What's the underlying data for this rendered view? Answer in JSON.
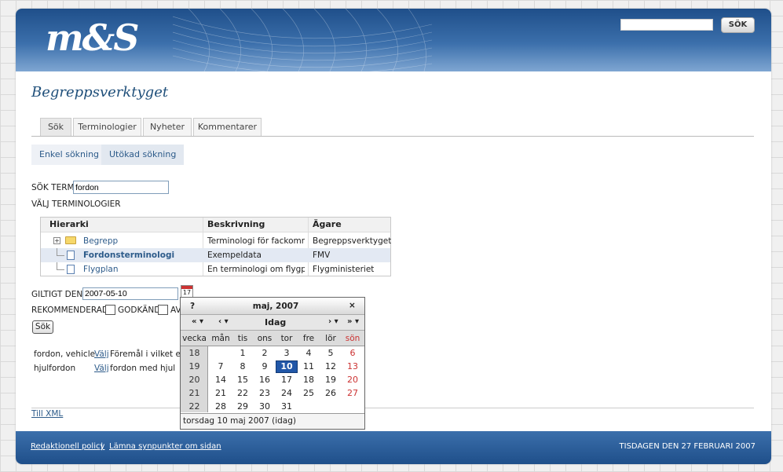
{
  "header": {
    "logo": "m&S",
    "search_placeholder": "",
    "search_button": "SÖK"
  },
  "page": {
    "title": "Begreppsverktyget"
  },
  "tabs": [
    "Sök",
    "Terminologier",
    "Nyheter",
    "Kommentarer"
  ],
  "subtabs": [
    "Enkel sökning",
    "Utökad sökning"
  ],
  "form": {
    "term_label": "SÖK TERM",
    "term_value": "fordon",
    "terminologies_label": "VÄLJ TERMINOLOGIER",
    "valid_label": "GILTIGT DEN",
    "valid_value": "2007-05-10",
    "calendar_icon_text": "17",
    "recommended_label": "REKOMMENDERAD",
    "approved_label": "GODKÄND",
    "av_label": "AV",
    "search_button": "Sök"
  },
  "tree": {
    "columns": [
      "Hierarki",
      "Beskrivning",
      "Ägare"
    ],
    "rows": [
      {
        "name": "Begrepp",
        "description": "Terminologi för fackområc",
        "owner": "Begreppsverktyget"
      },
      {
        "name": "Fordonsterminologi",
        "description": "Exempeldata",
        "owner": "FMV"
      },
      {
        "name": "Flygplan",
        "description": "En terminologi om flygplar",
        "owner": "Flygministeriet"
      }
    ]
  },
  "results": [
    {
      "term": "fordon, vehicle",
      "choose": "Välj",
      "text": "Föremål i vilket en"
    },
    {
      "term": "hjulfordon",
      "choose": "Välj",
      "text": "fordon med hjul"
    }
  ],
  "to_xml": "Till XML",
  "footer": {
    "policy": "Redaktionell policy",
    "separator": "|",
    "feedback": "Lämna synpunkter om sidan",
    "date": "TISDAGEN DEN 27 FEBRUARI 2007"
  },
  "calendar": {
    "help": "?",
    "title": "maj, 2007",
    "close": "×",
    "nav": {
      "prev_year": "«",
      "prev_month": "‹",
      "today": "Idag",
      "next_month": "›",
      "next_year": "»"
    },
    "week_header": "vecka",
    "days": [
      "mån",
      "tis",
      "ons",
      "tor",
      "fre",
      "lör",
      "sön"
    ],
    "weeks": [
      {
        "week": "18",
        "days": [
          "",
          "1",
          "2",
          "3",
          "4",
          "5",
          "6"
        ]
      },
      {
        "week": "19",
        "days": [
          "7",
          "8",
          "9",
          "10",
          "11",
          "12",
          "13"
        ]
      },
      {
        "week": "20",
        "days": [
          "14",
          "15",
          "16",
          "17",
          "18",
          "19",
          "20"
        ]
      },
      {
        "week": "21",
        "days": [
          "21",
          "22",
          "23",
          "24",
          "25",
          "26",
          "27"
        ]
      },
      {
        "week": "22",
        "days": [
          "28",
          "29",
          "30",
          "31",
          "",
          "",
          ""
        ]
      }
    ],
    "today": "10",
    "status": "torsdag 10 maj 2007 (idag)"
  }
}
